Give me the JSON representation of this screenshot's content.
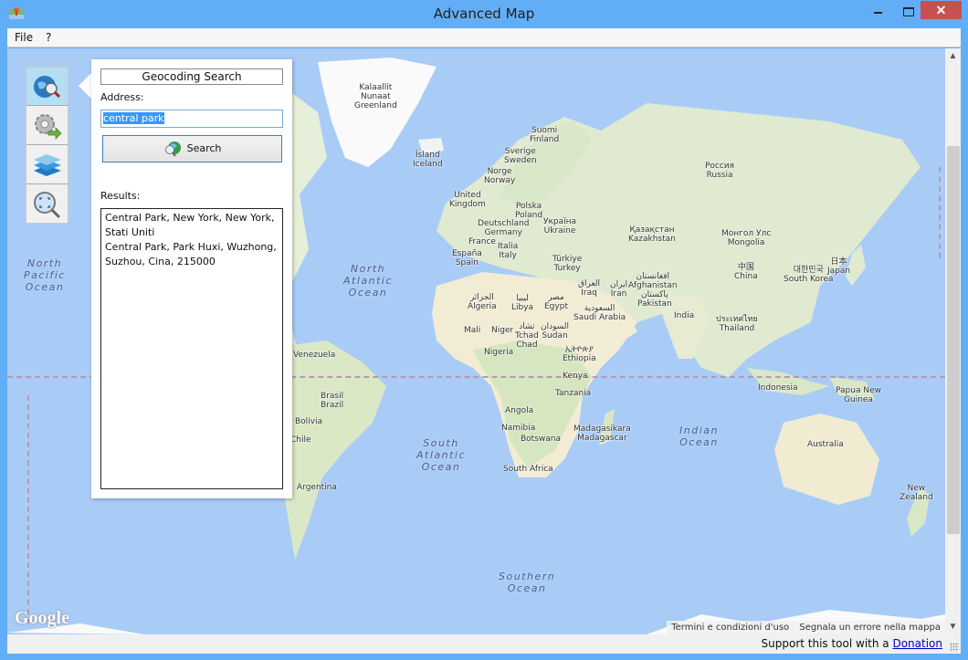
{
  "window": {
    "title": "Advanced Map",
    "close_glyph": "✕"
  },
  "menu": {
    "items": [
      "File",
      "?"
    ]
  },
  "toolstrip": {
    "tools": [
      {
        "name": "geocoding-search",
        "icon": "globe-search-icon",
        "active": true
      },
      {
        "name": "settings-export",
        "icon": "gear-arrow-icon",
        "active": false
      },
      {
        "name": "layers",
        "icon": "layers-icon",
        "active": false
      },
      {
        "name": "zoom-extent",
        "icon": "zoom-fit-icon",
        "active": false
      }
    ]
  },
  "geocoding_panel": {
    "title": "Geocoding Search",
    "address_label": "Address:",
    "address_value": "central park",
    "search_button": "Search",
    "results_label": "Results:",
    "results": [
      "Central Park, New York, New York, Stati Uniti",
      "Central Park, Park Huxi, Wuzhong, Suzhou, Cina, 215000"
    ]
  },
  "map": {
    "provider_logo": "Google",
    "footer": {
      "terms": "Termini e condizioni d'uso",
      "report": "Segnala un errore nella mappa"
    },
    "oceans": {
      "north_pacific": "North\nPacific\nOcean",
      "north_atlantic": "North\nAtlantic\nOcean",
      "south_atlantic": "South\nAtlantic\nOcean",
      "indian": "Indian\nOcean",
      "southern": "Southern\nOcean",
      "southern_left": "Southern\nOcean"
    },
    "labels": {
      "greenland": "Kalaallit\nNunaat\nGreenland",
      "iceland": "Ísland\nIceland",
      "finland": "Suomi\nFinland",
      "sweden": "Sverige\nSweden",
      "norway": "Norge\nNorway",
      "uk": "United\nKingdom",
      "poland": "Polska\nPoland",
      "germany": "Deutschland\nGermany",
      "ukraine": "Україна\nUkraine",
      "france": "France",
      "italy": "Italia\nItaly",
      "spain": "España\nSpain",
      "turkey": "Türkiye\nTurkey",
      "russia": "Россия\nRussia",
      "kazakhstan": "Қазақстан\nKazakhstan",
      "mongolia": "Монгол Улс\nMongolia",
      "china": "中国\nChina",
      "japan": "日本\nJapan",
      "south_korea": "대한민국\nSouth Korea",
      "afghanistan": "افغانستان\nAfghanistan",
      "pakistan": "پاکستان\nPakistan",
      "iran": "ایران\nIran",
      "iraq": "العراق\nIraq",
      "india": "India",
      "thailand": "ประเทศไทย\nThailand",
      "saudi": "السعودية\nSaudi Arabia",
      "egypt": "مصر\nEgypt",
      "libya": "ليبيا\nLibya",
      "algeria": "الجزائر\nAlgeria",
      "mali": "Mali",
      "niger": "Niger",
      "chad": "تشاد\nTchad\nChad",
      "sudan": "السودان\nSudan",
      "nigeria": "Nigeria",
      "ethiopia": "ኢትዮጵያ\nEthiopia",
      "kenya": "Kenya",
      "tanzania": "Tanzania",
      "angola": "Angola",
      "namibia": "Namibia",
      "botswana": "Botswana",
      "south_africa": "South Africa",
      "madagascar": "Madagasikara\nMadagascar",
      "indonesia": "Indonesia",
      "png": "Papua New\nGuinea",
      "australia": "Australia",
      "new_zealand": "New\nZealand",
      "venezuela": "Venezuela",
      "brazil": "Brasil\nBrazil",
      "bolivia": "Bolivia",
      "chile": "Chile",
      "argentina": "Argentina"
    }
  },
  "statusbar": {
    "support_text": "Support this tool with a ",
    "donation_link": "Donation"
  }
}
